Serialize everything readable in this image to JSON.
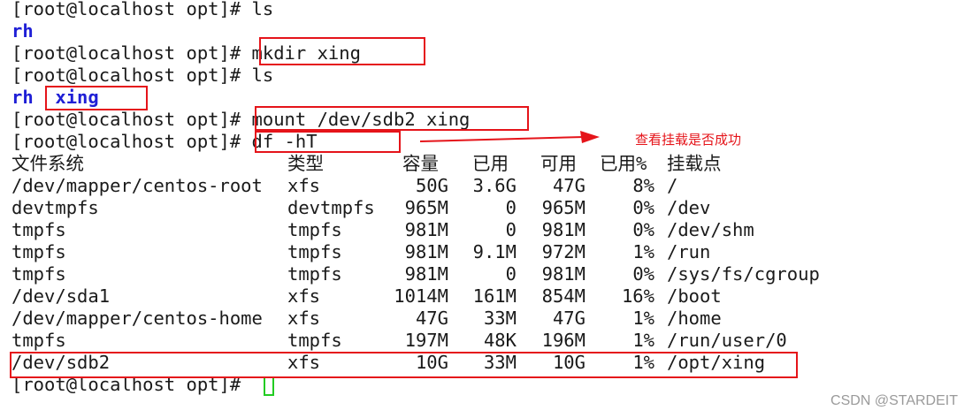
{
  "terminal": {
    "lines": [
      {
        "prompt": "[root@localhost opt]# ",
        "command": "ls"
      },
      {
        "output_dir": "rh"
      },
      {
        "prompt": "[root@localhost opt]# ",
        "command": "mkdir xing"
      },
      {
        "prompt": "[root@localhost opt]# ",
        "command": "ls"
      },
      {
        "output_dir": "rh",
        "output_dir2": "xing"
      },
      {
        "prompt": "[root@localhost opt]# ",
        "command": "mount /dev/sdb2 xing"
      },
      {
        "prompt": "[root@localhost opt]# ",
        "command": "df -hT"
      }
    ],
    "final_prompt": "[root@localhost opt]# "
  },
  "df_table": {
    "headers": [
      "文件系统",
      "类型",
      "容量",
      "已用",
      "可用",
      "已用%",
      "挂载点"
    ],
    "rows": [
      [
        "/dev/mapper/centos-root",
        "xfs",
        "50G",
        "3.6G",
        "47G",
        "8%",
        "/"
      ],
      [
        "devtmpfs",
        "devtmpfs",
        "965M",
        "0",
        "965M",
        "0%",
        "/dev"
      ],
      [
        "tmpfs",
        "tmpfs",
        "981M",
        "0",
        "981M",
        "0%",
        "/dev/shm"
      ],
      [
        "tmpfs",
        "tmpfs",
        "981M",
        "9.1M",
        "972M",
        "1%",
        "/run"
      ],
      [
        "tmpfs",
        "tmpfs",
        "981M",
        "0",
        "981M",
        "0%",
        "/sys/fs/cgroup"
      ],
      [
        "/dev/sda1",
        "xfs",
        "1014M",
        "161M",
        "854M",
        "16%",
        "/boot"
      ],
      [
        "/dev/mapper/centos-home",
        "xfs",
        "47G",
        "33M",
        "47G",
        "1%",
        "/home"
      ],
      [
        "tmpfs",
        "tmpfs",
        "197M",
        "48K",
        "196M",
        "1%",
        "/run/user/0"
      ],
      [
        "/dev/sdb2",
        "xfs",
        "10G",
        "33M",
        "10G",
        "1%",
        "/opt/xing"
      ]
    ]
  },
  "annotation": {
    "text": "查看挂载是否成功",
    "color": "#e5141a"
  },
  "watermark": "CSDN @STARDEIT",
  "colors": {
    "background": "#ffffff",
    "text": "#1a1a1a",
    "directory": "#1f1fd6",
    "highlight_box": "#e5141a",
    "cursor": "#22cc22"
  }
}
